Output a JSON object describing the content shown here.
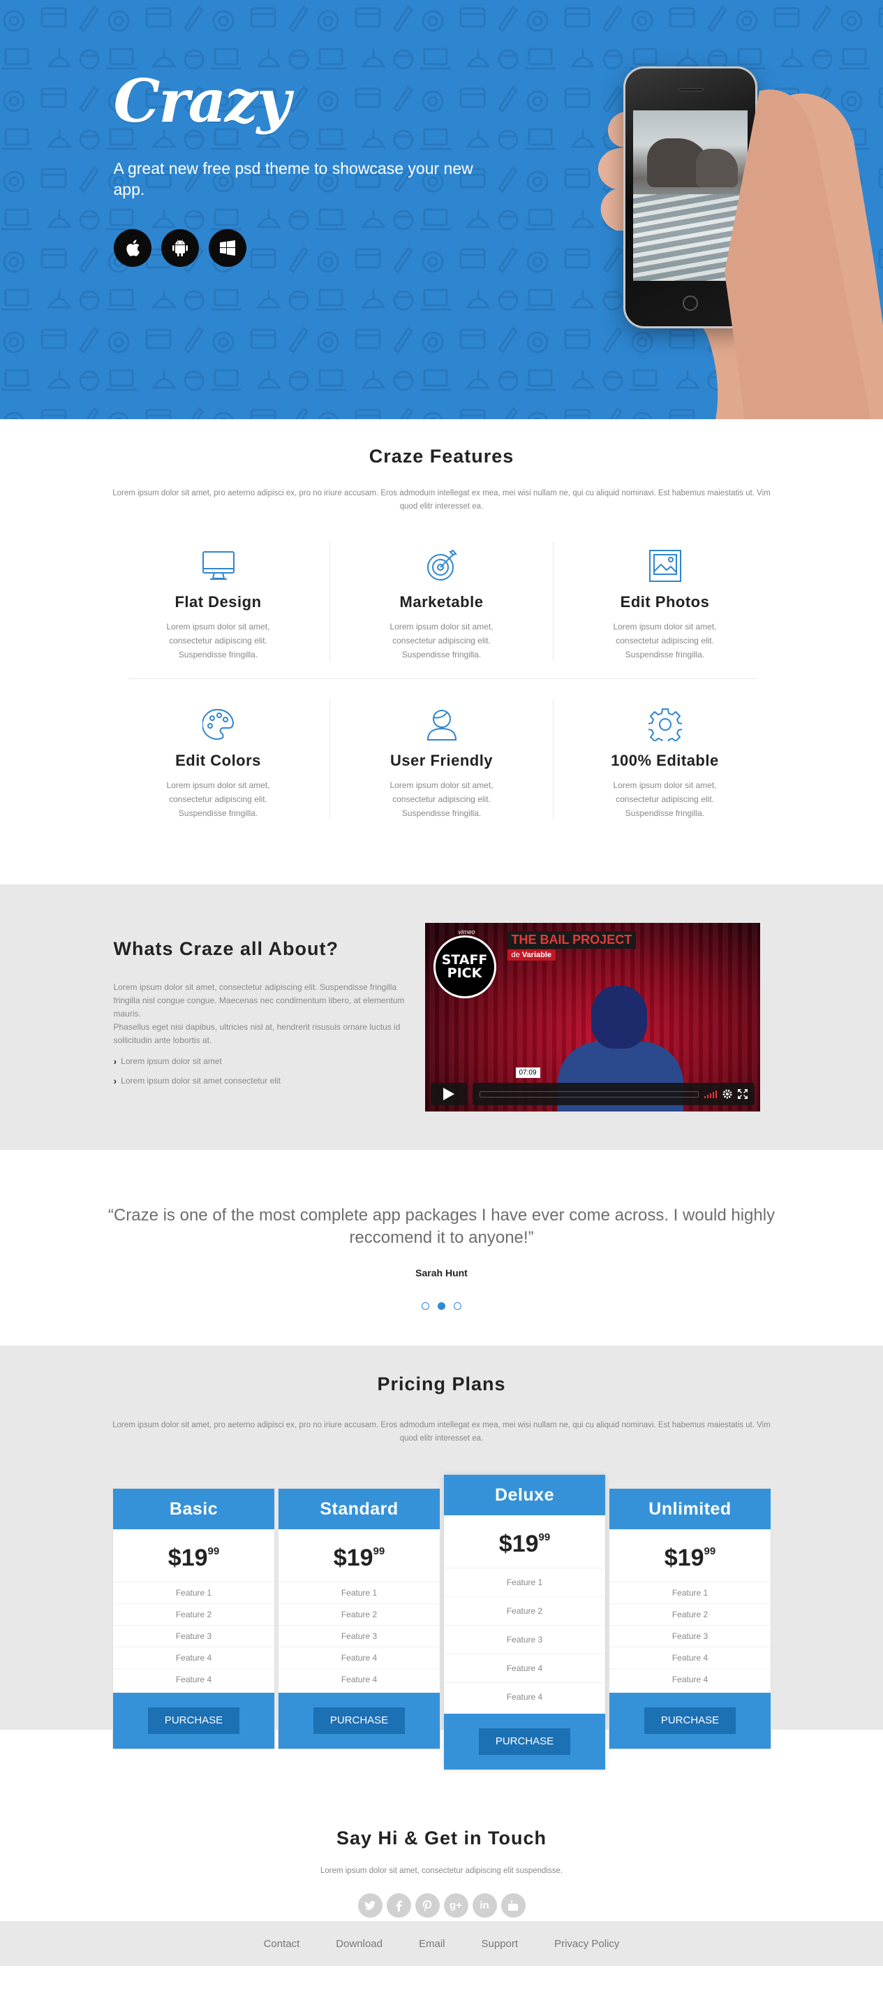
{
  "hero": {
    "logo": "Crazy",
    "tagline": "A great new free psd theme to showcase your new app.",
    "stores": [
      {
        "icon": "apple-icon"
      },
      {
        "icon": "android-icon"
      },
      {
        "icon": "windows-icon"
      }
    ],
    "bg_color": "#2e86d0"
  },
  "features": {
    "title": "Craze Features",
    "description": "Lorem ipsum dolor sit amet, pro aeterno adipisci ex, pro no iriure accusam. Eros admodum intellegat ex mea, mei wisi nullam ne, qui cu aliquid nominavi. Est habemus maiestatis ut. Vim quod elitr interesset ea.",
    "items": [
      {
        "icon": "monitor-icon",
        "title": "Flat Design",
        "text": "Lorem ipsum dolor sit amet, consectetur adipiscing elit. Suspendisse fringilla."
      },
      {
        "icon": "target-icon",
        "title": "Marketable",
        "text": "Lorem ipsum dolor sit amet, consectetur adipiscing elit. Suspendisse fringilla."
      },
      {
        "icon": "image-icon",
        "title": "Edit Photos",
        "text": "Lorem ipsum dolor sit amet, consectetur adipiscing elit. Suspendisse fringilla."
      },
      {
        "icon": "palette-icon",
        "title": "Edit Colors",
        "text": "Lorem ipsum dolor sit amet, consectetur adipiscing elit. Suspendisse fringilla."
      },
      {
        "icon": "user-icon",
        "title": "User Friendly",
        "text": "Lorem ipsum dolor sit amet, consectetur adipiscing elit. Suspendisse fringilla."
      },
      {
        "icon": "gear-icon",
        "title": "100% Editable",
        "text": "Lorem ipsum dolor sit amet, consectetur adipiscing elit. Suspendisse fringilla."
      }
    ]
  },
  "about": {
    "title": "Whats Craze all About?",
    "paragraph1": "Lorem ipsum dolor sit amet, consectetur adipiscing elit. Suspendisse fringilla fringilla nisl congue congue. Maecenas nec condimentum libero, at elementum mauris.",
    "paragraph2": "Phasellus eget nisi dapibus, ultricies nisl at, hendrerit risusuis ornare luctus id sollicitudin ante lobortis at.",
    "list": [
      "Lorem ipsum dolor sit amet",
      "Lorem ipsum dolor sit amet consectetur elit"
    ],
    "video": {
      "badge_line1": "STAFF",
      "badge_line2": "PICK",
      "vimeo": "vimeo",
      "title": "THE BAIL PROJECT",
      "by": "de",
      "author": "Variable",
      "time": "07:09"
    }
  },
  "testimonial": {
    "quote": "“Craze is one of the most complete app packages I have ever come across. I would highly reccomend it to anyone!”",
    "author": "Sarah Hunt",
    "dots": 3,
    "active_dot": 1
  },
  "pricing": {
    "title": "Pricing Plans",
    "description": "Lorem ipsum dolor sit amet, pro aeterno adipisci ex, pro no iriure accusam. Eros admodum intellegat ex mea, mei wisi nullam ne, qui cu aliquid nominavi. Est habemus maiestatis ut. Vim quod elitr interesset ea.",
    "accent": "#3592d9",
    "plans": [
      {
        "name": "Basic",
        "price": "$19",
        "cents": "99",
        "features": [
          "Feature 1",
          "Feature 2",
          "Feature 3",
          "Feature 4",
          "Feature 4"
        ],
        "button": "PURCHASE"
      },
      {
        "name": "Standard",
        "price": "$19",
        "cents": "99",
        "features": [
          "Feature 1",
          "Feature 2",
          "Feature 3",
          "Feature 4",
          "Feature 4"
        ],
        "button": "PURCHASE"
      },
      {
        "name": "Deluxe",
        "price": "$19",
        "cents": "99",
        "features": [
          "Feature 1",
          "Feature 2",
          "Feature 3",
          "Feature 4",
          "Feature 4"
        ],
        "button": "PURCHASE"
      },
      {
        "name": "Unlimited",
        "price": "$19",
        "cents": "99",
        "features": [
          "Feature 1",
          "Feature 2",
          "Feature 3",
          "Feature 4",
          "Feature 4"
        ],
        "button": "PURCHASE"
      }
    ]
  },
  "contact": {
    "title": "Say Hi & Get in Touch",
    "description": "Lorem ipsum dolor sit amet, consectetur adipiscing elit suspendisse.",
    "socials": [
      {
        "icon": "twitter-icon"
      },
      {
        "icon": "facebook-icon"
      },
      {
        "icon": "pinterest-icon"
      },
      {
        "icon": "google-plus-icon"
      },
      {
        "icon": "linkedin-icon"
      },
      {
        "icon": "youtube-icon"
      }
    ]
  },
  "footer": {
    "links": [
      "Contact",
      "Download",
      "Email",
      "Support",
      "Privacy Policy"
    ]
  }
}
